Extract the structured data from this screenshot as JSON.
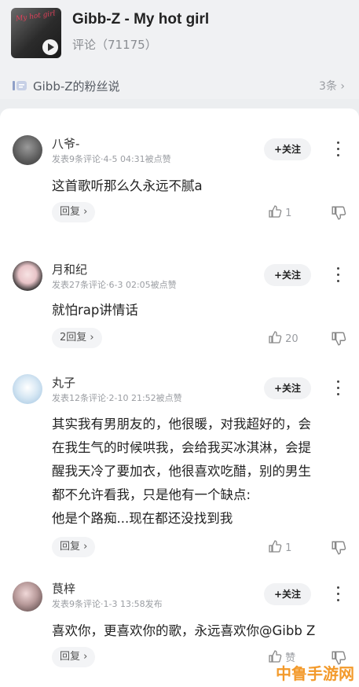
{
  "header": {
    "cover_text": "My hot girl",
    "title": "Gibb-Z - My hot girl",
    "comment_count": "评论（71175）"
  },
  "fan_bar": {
    "label": "Gibb-Z的粉丝说",
    "count": "3条 ›"
  },
  "follow_label": "+关注",
  "comments": [
    {
      "nick": "八爷-",
      "meta": "发表9条评论·4-5 04:31被点赞",
      "lines": [
        "这首歌听那么久永远不腻a"
      ],
      "reply": "回复 ›",
      "likes": "1"
    },
    {
      "nick": "月和纪",
      "meta": "发表27条评论·6-3 02:05被点赞",
      "lines": [
        "就怕rap讲情话"
      ],
      "reply": "2回复 ›",
      "likes": "20"
    },
    {
      "nick": "丸子",
      "meta": "发表12条评论·2-10 21:52被点赞",
      "lines": [
        "其实我有男朋友的，他很暖，对我超好的，会",
        "在我生气的时候哄我，会给我买冰淇淋，会提",
        "醒我天冷了要加衣，他很喜欢吃醋，别的男生",
        "都不允许看我，只是他有一个缺点:",
        "他是个路痴...现在都还没找到我"
      ],
      "reply": "回复 ›",
      "likes": "1"
    },
    {
      "nick": "茛梓",
      "meta": "发表9条评论·1-3 13:58发布",
      "lines": [
        "喜欢你，更喜欢你的歌，永远喜欢你@Gibb Z"
      ],
      "reply": "回复 ›",
      "likes": "赞"
    }
  ],
  "watermark": "中鲁手游网",
  "colors": {
    "background": "#eceef0",
    "card": "#ffffff",
    "muted_text": "#9a9da2",
    "watermark": "#f39a2b"
  }
}
